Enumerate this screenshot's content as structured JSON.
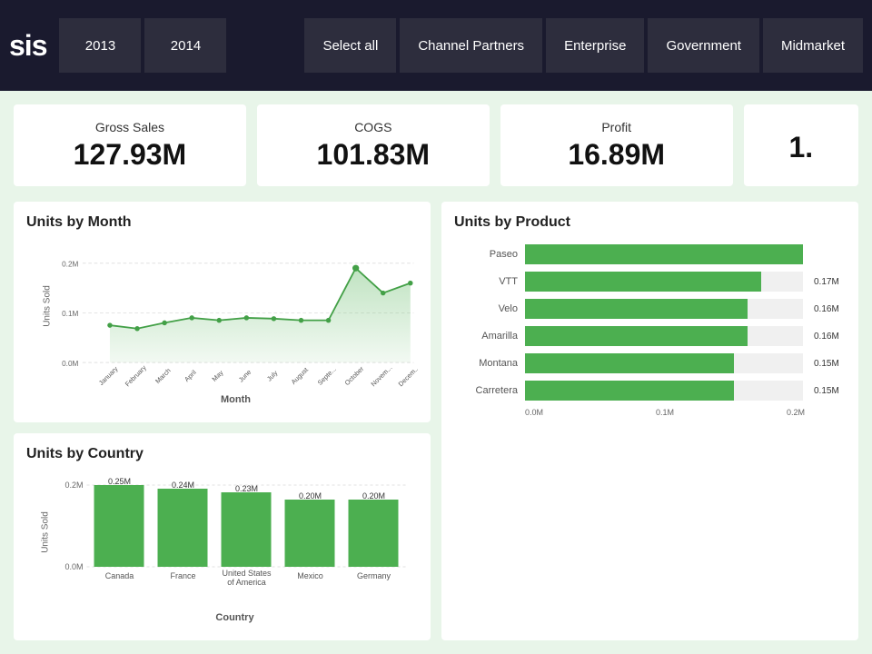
{
  "header": {
    "logo": "sis",
    "nav_buttons": [
      {
        "label": "2013",
        "id": "btn-2013"
      },
      {
        "label": "2014",
        "id": "btn-2014"
      },
      {
        "label": "Select all",
        "id": "btn-select-all"
      },
      {
        "label": "Channel Partners",
        "id": "btn-channel"
      },
      {
        "label": "Enterprise",
        "id": "btn-enterprise"
      },
      {
        "label": "Government",
        "id": "btn-government"
      },
      {
        "label": "Midmarket",
        "id": "btn-midmarket"
      }
    ]
  },
  "kpis": [
    {
      "label": "Gross Sales",
      "value": "127.93M",
      "id": "kpi-gross-sales"
    },
    {
      "label": "COGS",
      "value": "101.83M",
      "id": "kpi-cogs"
    },
    {
      "label": "Profit",
      "value": "16.89M",
      "id": "kpi-profit"
    },
    {
      "label": "",
      "value": "1.",
      "id": "kpi-extra"
    }
  ],
  "units_by_month": {
    "title": "Units by Month",
    "y_label": "Units Sold",
    "x_label": "Month",
    "y_ticks": [
      "0.2M",
      "0.1M"
    ],
    "months": [
      "January",
      "February",
      "March",
      "April",
      "May",
      "June",
      "July",
      "August",
      "Septe...",
      "October",
      "Novem...",
      "Decem..."
    ],
    "values": [
      0.075,
      0.068,
      0.08,
      0.09,
      0.085,
      0.09,
      0.088,
      0.085,
      0.085,
      0.19,
      0.14,
      0.16
    ]
  },
  "units_by_country": {
    "title": "Units by Country",
    "y_label": "Units Sold",
    "x_label": "Country",
    "y_ticks": [
      "0.2M",
      "0.0M"
    ],
    "bars": [
      {
        "country": "Canada",
        "value": 0.25,
        "label": "0.25M"
      },
      {
        "country": "France",
        "value": 0.24,
        "label": "0.24M"
      },
      {
        "country": "United States of America",
        "value": 0.23,
        "label": "0.23M"
      },
      {
        "country": "Mexico",
        "value": 0.2,
        "label": "0.20M"
      },
      {
        "country": "Germany",
        "value": 0.2,
        "label": "0.20M"
      }
    ]
  },
  "units_by_product": {
    "title": "Units by Product",
    "x_ticks": [
      "0.0M",
      "0.1M",
      "0.2M"
    ],
    "bars": [
      {
        "product": "Paseo",
        "value": 1.0,
        "label": ""
      },
      {
        "product": "VTT",
        "value": 0.85,
        "label": "0.17M"
      },
      {
        "product": "Velo",
        "value": 0.8,
        "label": "0.16M"
      },
      {
        "product": "Amarilla",
        "value": 0.8,
        "label": "0.16M"
      },
      {
        "product": "Montana",
        "value": 0.75,
        "label": "0.15M"
      },
      {
        "product": "Carretera",
        "value": 0.75,
        "label": "0.15M"
      }
    ]
  }
}
